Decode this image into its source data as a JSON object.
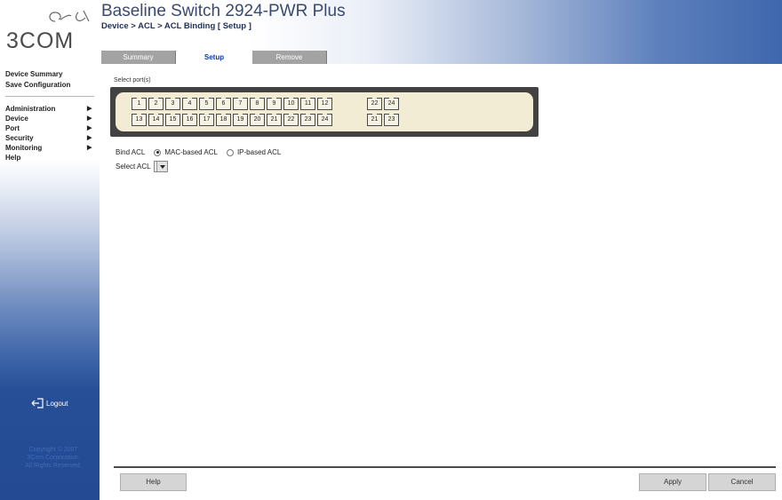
{
  "brand": {
    "logo_text": "3COM"
  },
  "header": {
    "title": "Baseline Switch 2924-PWR Plus",
    "breadcrumb": "Device > ACL > ACL Binding [ Setup ]"
  },
  "tabs": [
    {
      "label": "Summary",
      "active": false
    },
    {
      "label": "Setup",
      "active": true
    },
    {
      "label": "Remove",
      "active": false
    }
  ],
  "sidebar": {
    "top_links": [
      "Device Summary",
      "Save Configuration"
    ],
    "menu": [
      {
        "label": "Administration",
        "has_submenu": true
      },
      {
        "label": "Device",
        "has_submenu": true
      },
      {
        "label": "Port",
        "has_submenu": true
      },
      {
        "label": "Security",
        "has_submenu": true
      },
      {
        "label": "Monitoring",
        "has_submenu": true
      },
      {
        "label": "Help",
        "has_submenu": false
      }
    ],
    "logout_label": "Logout",
    "copyright": [
      "Copyright © 2007",
      "3Com Corporation.",
      "All Rights Reserved."
    ]
  },
  "main": {
    "select_ports_label": "Select port(s)",
    "ports_top_row": [
      "1",
      "2",
      "3",
      "4",
      "5",
      "6",
      "7",
      "8",
      "9",
      "10",
      "11",
      "12"
    ],
    "ports_bottom_row": [
      "13",
      "14",
      "15",
      "16",
      "17",
      "18",
      "19",
      "20",
      "21",
      "22",
      "23",
      "24"
    ],
    "uplink_top_row": [
      "22",
      "24"
    ],
    "uplink_bottom_row": [
      "21",
      "23"
    ],
    "bind_acl_label": "Bind ACL",
    "bind_options": [
      {
        "label": "MAC-based ACL",
        "checked": true
      },
      {
        "label": "IP-based ACL",
        "checked": false
      }
    ],
    "select_acl_label": "Select ACL",
    "select_acl_value": ""
  },
  "footer": {
    "help_label": "Help",
    "apply_label": "Apply",
    "cancel_label": "Cancel"
  },
  "colors": {
    "sidebar_blue": "#234a92",
    "active_tab_text": "#0e38a1",
    "inactive_tab": "#a3a3a3",
    "port_panel_bg": "#424242",
    "port_inner_bg": "#f2ecd4"
  },
  "icons": {
    "logout": "logout-icon",
    "logo": "3com-logo-swirl-icon",
    "submenu": "chevron-right-icon",
    "dropdown": "dropdown-arrow-icon"
  }
}
